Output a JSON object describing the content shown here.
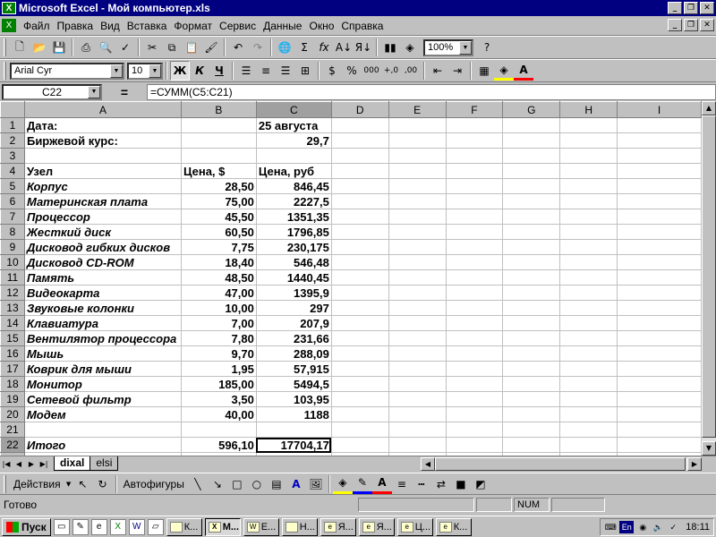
{
  "window": {
    "title": "Microsoft Excel - Мой компьютер.xls",
    "app_icon": "excel-icon"
  },
  "menu": {
    "items": [
      "Файл",
      "Правка",
      "Вид",
      "Вставка",
      "Формат",
      "Сервис",
      "Данные",
      "Окно",
      "Справка"
    ]
  },
  "standard_toolbar": {
    "zoom": "100%"
  },
  "format_toolbar": {
    "font": "Arial Cyr",
    "size": "10",
    "bold": "Ж",
    "italic": "К",
    "underline": "Ч",
    "percent": "%",
    "thousands": "000"
  },
  "formula_bar": {
    "cell_ref": "C22",
    "equals": "=",
    "formula": "=СУММ(C5:C21)"
  },
  "sheet": {
    "columns": [
      "A",
      "B",
      "C",
      "D",
      "E",
      "F",
      "G",
      "H",
      "I"
    ],
    "rows": [
      {
        "n": "1",
        "a": "Дата:",
        "b": "",
        "c": "25 августа",
        "a_style": "b",
        "c_style": "b"
      },
      {
        "n": "2",
        "a": "Биржевой курс:",
        "b": "",
        "c": "29,7",
        "a_style": "b",
        "c_style": "b num"
      },
      {
        "n": "3",
        "a": "",
        "b": "",
        "c": ""
      },
      {
        "n": "4",
        "a": "Узел",
        "b": "Цена, $",
        "c": "Цена, руб",
        "a_style": "b",
        "b_style": "b",
        "c_style": "b"
      },
      {
        "n": "5",
        "a": "Корпус",
        "b": "28,50",
        "c": "846,45"
      },
      {
        "n": "6",
        "a": "Материнская плата",
        "b": "75,00",
        "c": "2227,5"
      },
      {
        "n": "7",
        "a": "Процессор",
        "b": "45,50",
        "c": "1351,35"
      },
      {
        "n": "8",
        "a": "Жесткий диск",
        "b": "60,50",
        "c": "1796,85"
      },
      {
        "n": "9",
        "a": "Дисковод гибких дисков",
        "b": "7,75",
        "c": "230,175"
      },
      {
        "n": "10",
        "a": "Дисковод CD-ROM",
        "b": "18,40",
        "c": "546,48"
      },
      {
        "n": "11",
        "a": "Память",
        "b": "48,50",
        "c": "1440,45"
      },
      {
        "n": "12",
        "a": "Видеокарта",
        "b": "47,00",
        "c": "1395,9"
      },
      {
        "n": "13",
        "a": "Звуковые колонки",
        "b": "10,00",
        "c": "297"
      },
      {
        "n": "14",
        "a": "Клавиатура",
        "b": "7,00",
        "c": "207,9"
      },
      {
        "n": "15",
        "a": "Вентилятор процессора",
        "b": "7,80",
        "c": "231,66"
      },
      {
        "n": "16",
        "a": "Мышь",
        "b": "9,70",
        "c": "288,09"
      },
      {
        "n": "17",
        "a": "Коврик для мыши",
        "b": "1,95",
        "c": "57,915"
      },
      {
        "n": "18",
        "a": "Монитор",
        "b": "185,00",
        "c": "5494,5"
      },
      {
        "n": "19",
        "a": "Сетевой фильтр",
        "b": "3,50",
        "c": "103,95"
      },
      {
        "n": "20",
        "a": "Модем",
        "b": "40,00",
        "c": "1188"
      },
      {
        "n": "21",
        "a": "",
        "b": "",
        "c": ""
      },
      {
        "n": "22",
        "a": "Итого",
        "b": "596,10",
        "c": "17704,17"
      },
      {
        "n": "23",
        "a": "",
        "b": "",
        "c": ""
      }
    ]
  },
  "tabs": {
    "items": [
      "dixal",
      "elsi"
    ],
    "active": "dixal"
  },
  "drawing_toolbar": {
    "actions": "Действия",
    "autoshapes": "Автофигуры"
  },
  "status": {
    "text": "Готово",
    "num": "NUM"
  },
  "taskbar": {
    "start": "Пуск",
    "buttons": [
      "К...",
      "М...",
      "Е...",
      "Н...",
      "Я...",
      "Я...",
      "Ц...",
      "К..."
    ],
    "lang": "En",
    "clock": "18:11"
  }
}
